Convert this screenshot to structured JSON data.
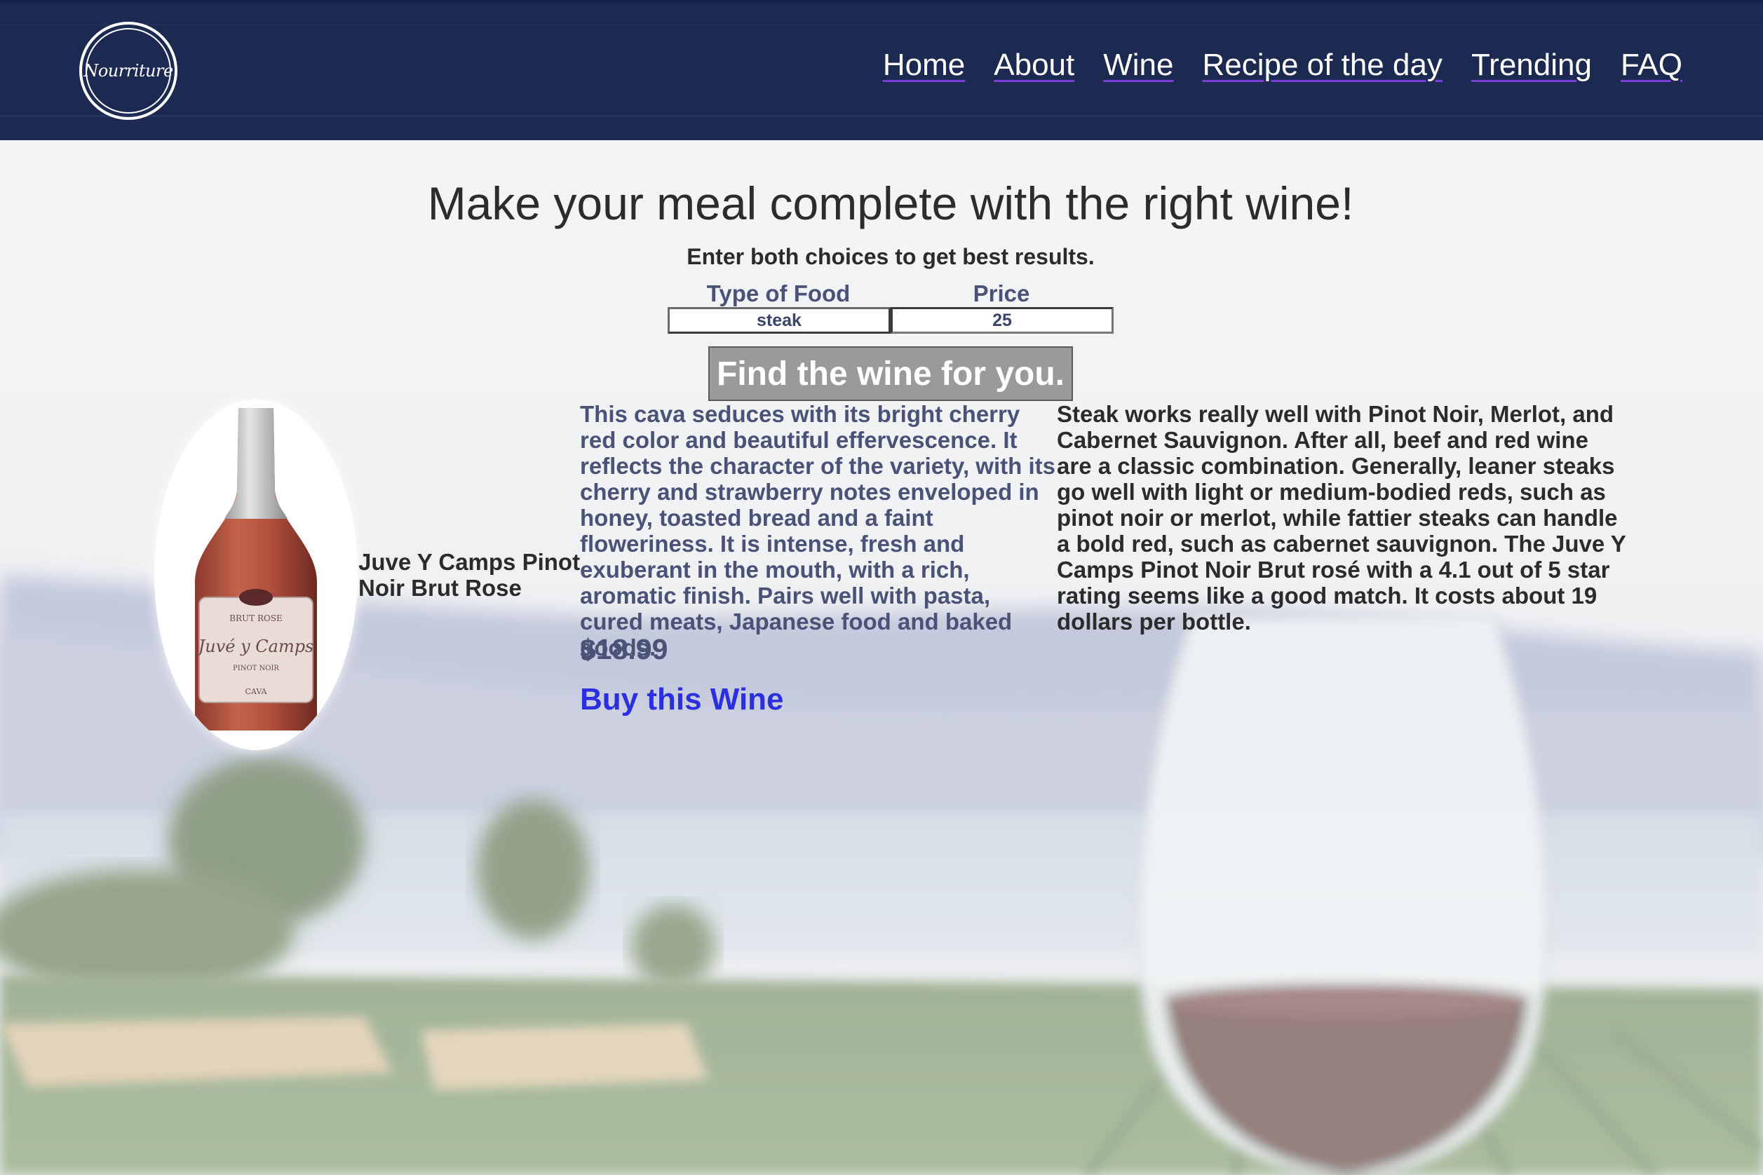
{
  "brand": {
    "logo_text": "Nourriture"
  },
  "nav": {
    "items": [
      {
        "label": "Home"
      },
      {
        "label": "About"
      },
      {
        "label": "Wine"
      },
      {
        "label": "Recipe of the day"
      },
      {
        "label": "Trending"
      },
      {
        "label": "FAQ"
      }
    ]
  },
  "main": {
    "title": "Make your meal complete with the right wine!",
    "subtitle": "Enter both choices to get best results.",
    "form": {
      "food_label": "Type of Food",
      "food_value": "steak",
      "price_label": "Price",
      "price_value": "25",
      "submit_label": "Find the wine for you."
    }
  },
  "result": {
    "wine_name": "Juve Y Camps Pinot Noir Brut Rose",
    "bottle_label": {
      "top": "BRUT ROSE",
      "brand": "Juvé y Camps",
      "variety": "PINOT NOIR",
      "type": "CAVA"
    },
    "description": "This cava seduces with its bright cherry red color and beautiful effervescence. It reflects the character of the variety, with its cherry and strawberry notes enveloped in honey, toasted bread and a faint floweriness. It is intense, fresh and exuberant in the mouth, with a rich, aromatic finish. Pairs well with pasta, cured meats, Japanese food and baked goods.",
    "price": "$18.99",
    "buy_label": "Buy this Wine",
    "pairing_text": "Steak works really well with Pinot Noir, Merlot, and Cabernet Sauvignon. After all, beef and red wine are a classic combination. Generally, leaner steaks go well with light or medium-bodied reds, such as pinot noir or merlot, while fattier steaks can handle a bold red, such as cabernet sauvignon. The Juve Y Camps Pinot Noir Brut rosé with a 4.1 out of 5 star rating seems like a good match. It costs about 19 dollars per bottle."
  },
  "colors": {
    "header_bg": "#1c2951",
    "nav_underline": "#7a3fd6",
    "accent_text": "#4a5377",
    "link": "#2c2fe0",
    "button_bg": "#9a9a98"
  },
  "icons": {
    "logo": "circle-logo",
    "bottle": "wine-bottle-image",
    "glass": "wine-glass-image"
  }
}
